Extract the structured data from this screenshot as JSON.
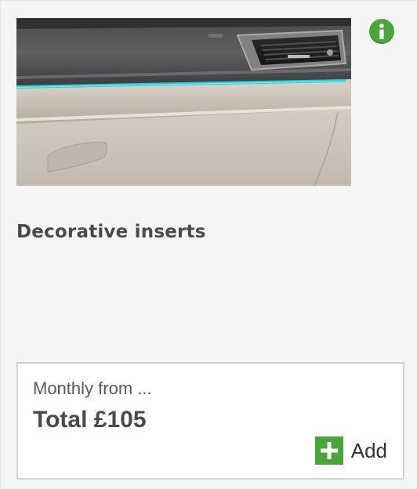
{
  "product": {
    "title": "Decorative inserts",
    "image_alt": "Dashboard decorative insert with ambient light strip"
  },
  "info": {
    "icon": "info-icon",
    "color": "#4aa53a"
  },
  "pricing": {
    "monthly_label": "Monthly from ...",
    "total_label": "Total £105"
  },
  "actions": {
    "add_label": "Add",
    "add_icon": "plus-icon",
    "accent": "#4aa53a"
  }
}
